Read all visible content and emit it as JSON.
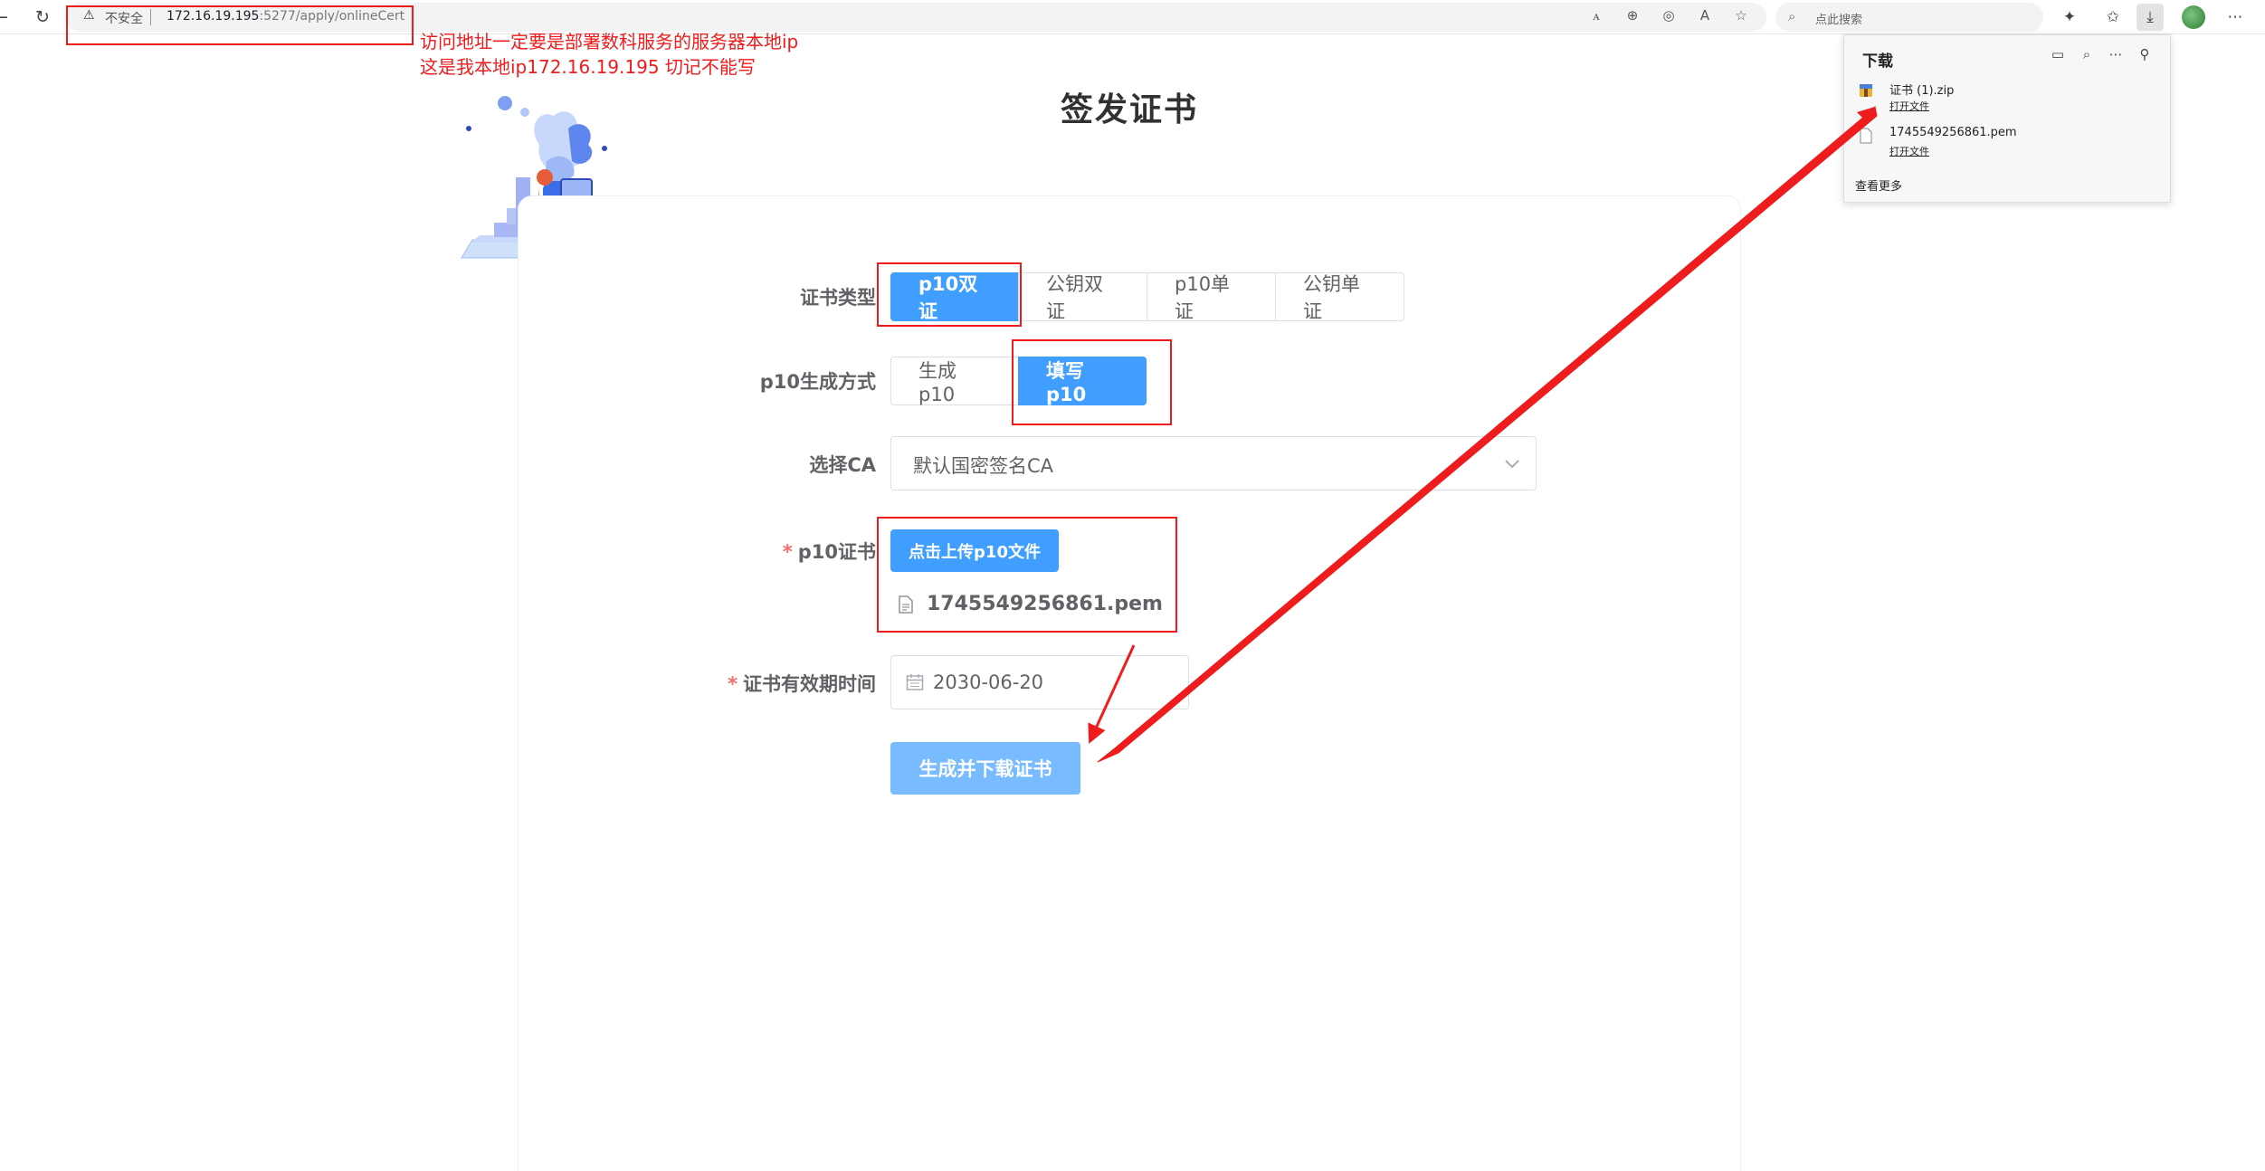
{
  "browser": {
    "insecure_label": "不安全",
    "url_host": "172.16.19.195",
    "url_rest": ":5277/apply/onlineCert",
    "search_placeholder": "点此搜索"
  },
  "page": {
    "title": "签发证书"
  },
  "form": {
    "cert_type": {
      "label": "证书类型",
      "options": [
        "p10双证",
        "公钥双证",
        "p10单证",
        "公钥单证"
      ],
      "selected": "p10双证"
    },
    "p10_method": {
      "label": "p10生成方式",
      "options": [
        "生成p10",
        "填写p10"
      ],
      "selected": "填写p10"
    },
    "ca": {
      "label": "选择CA",
      "value": "默认国密签名CA"
    },
    "p10_cert": {
      "label": "p10证书",
      "required_mark": "*",
      "upload_label": "点击上传p10文件",
      "file_name": "1745549256861.pem"
    },
    "validity": {
      "label": "证书有效期时间",
      "required_mark": "*",
      "value": "2030-06-20"
    },
    "submit_label": "生成并下载证书"
  },
  "downloads": {
    "title": "下载",
    "items": [
      {
        "name": "证书 (1).zip",
        "action": "打开文件"
      },
      {
        "name": "1745549256861.pem",
        "action": "打开文件"
      }
    ],
    "more": "查看更多"
  },
  "annotation": {
    "line1": "访问地址一定要是部署数科服务的服务器本地ip",
    "line2": "这是我本地ip172.16.19.195 切记不能写",
    "color": "#ee1c1c"
  },
  "colors": {
    "primary": "#409eff",
    "primary_light": "#79bbff",
    "required": "#f56c6c"
  }
}
